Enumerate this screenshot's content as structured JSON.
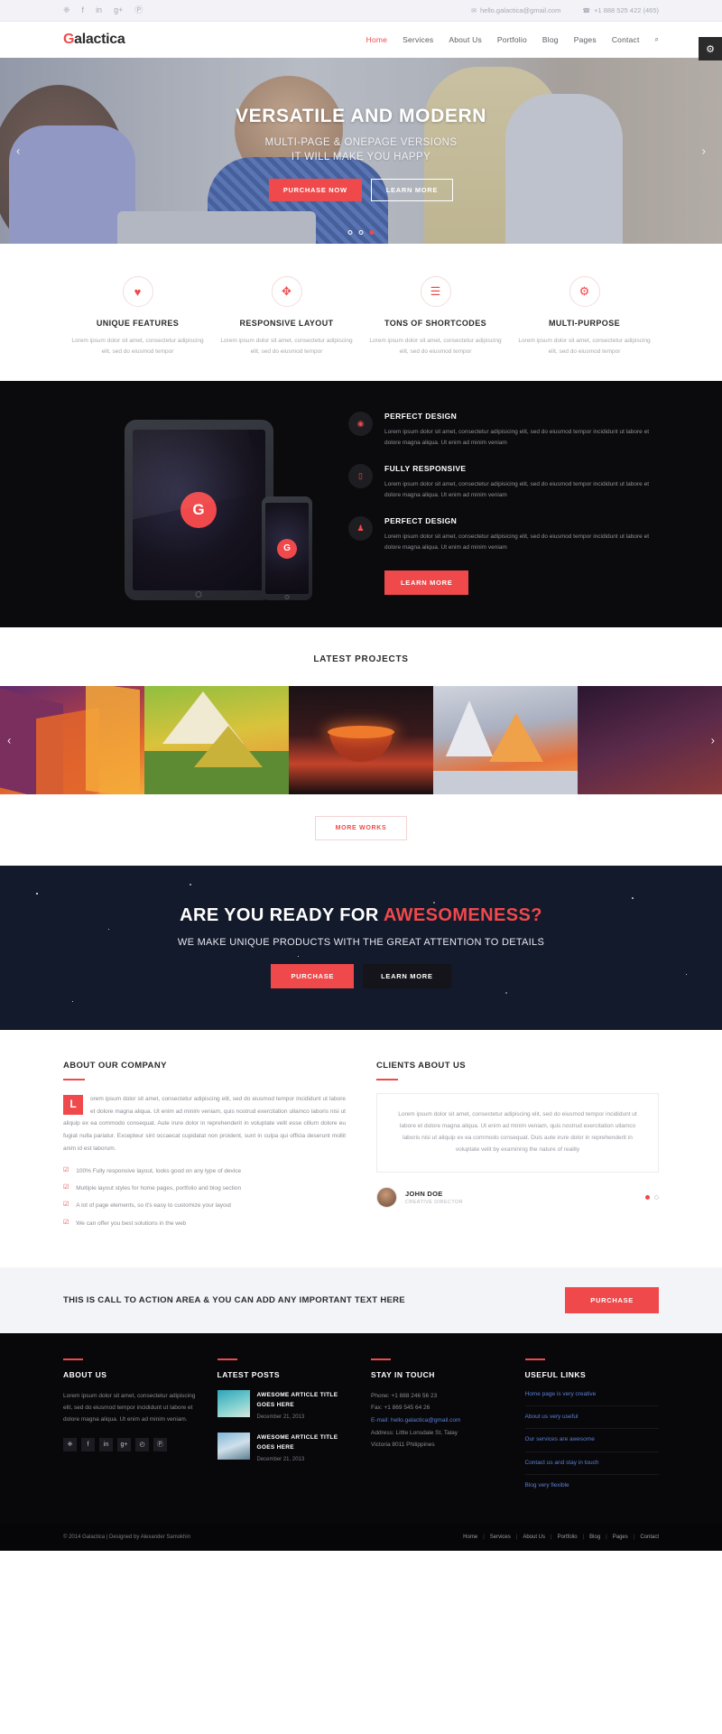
{
  "topbar": {
    "social": [
      {
        "name": "twitter-icon",
        "glyph": "❈"
      },
      {
        "name": "facebook-icon",
        "glyph": "f"
      },
      {
        "name": "linkedin-icon",
        "glyph": "in"
      },
      {
        "name": "google-plus-icon",
        "glyph": "g+"
      },
      {
        "name": "pinterest-icon",
        "glyph": "Ⓟ"
      }
    ],
    "email_icon": "✉",
    "email": "hello.galactica@gmail.com",
    "phone_icon": "☎",
    "phone": "+1 888 525 422 (465)"
  },
  "header": {
    "logo_accent": "G",
    "logo_rest": "alactica",
    "nav": [
      {
        "label": "Home",
        "active": true
      },
      {
        "label": "Services",
        "active": false
      },
      {
        "label": "About Us",
        "active": false
      },
      {
        "label": "Portfolio",
        "active": false
      },
      {
        "label": "Blog",
        "active": false
      },
      {
        "label": "Pages",
        "active": false
      },
      {
        "label": "Contact",
        "active": false
      }
    ],
    "search_icon": "⌕",
    "gear_icon": "⚙"
  },
  "hero": {
    "title": "VERSATILE AND MODERN",
    "subtitle_line1": "MULTI-PAGE & ONEPAGE VERSIONS",
    "subtitle_line2": "IT WILL MAKE YOU HAPPY",
    "btn_primary": "PURCHASE NOW",
    "btn_secondary": "LEARN MORE",
    "prev_icon": "‹",
    "next_icon": "›",
    "slide_count": 3,
    "active_slide": 3
  },
  "features": [
    {
      "icon": "♥",
      "icon_name": "heart-icon",
      "title": "UNIQUE FEATURES",
      "desc": "Lorem ipsum dolor sit amet, consectetur adipiscing elit, sed do eiusmod tempor"
    },
    {
      "icon": "✥",
      "icon_name": "expand-arrows-icon",
      "title": "RESPONSIVE LAYOUT",
      "desc": "Lorem ipsum dolor sit amet, consectetur adipiscing elit, sed do eiusmod tempor"
    },
    {
      "icon": "☰",
      "icon_name": "lines-list-icon",
      "title": "TONS OF SHORTCODES",
      "desc": "Lorem ipsum dolor sit amet, consectetur adipiscing elit, sed do eiusmod tempor"
    },
    {
      "icon": "⚙",
      "icon_name": "gears-icon",
      "title": "MULTI-PURPOSE",
      "desc": "Lorem ipsum dolor sit amet, consectetur adipiscing elit, sed do eiusmod tempor"
    }
  ],
  "showcase": {
    "device_letter": "G",
    "items": [
      {
        "icon": "◉",
        "icon_name": "eye-icon",
        "title": "PERFECT DESIGN",
        "desc": "Lorem ipsum dolor sit amet, consectetur adipisicing elit, sed do eiusmod tempor incididunt ut labore et dolore magna aliqua. Ut enim ad minim veniam"
      },
      {
        "icon": "▯",
        "icon_name": "mobile-icon",
        "title": "FULLY RESPONSIVE",
        "desc": "Lorem ipsum dolor sit amet, consectetur adipisicing elit, sed do eiusmod tempor incididunt ut labore et dolore magna aliqua. Ut enim ad minim veniam"
      },
      {
        "icon": "♟",
        "icon_name": "rocket-icon",
        "title": "PERFECT DESIGN",
        "desc": "Lorem ipsum dolor sit amet, consectetur adipisicing elit, sed do eiusmod tempor incididunt ut labore et dolore magna aliqua. Ut enim ad minim veniam"
      }
    ],
    "btn": "LEARN MORE"
  },
  "projects": {
    "title": "LATEST PROJECTS",
    "prev_icon": "‹",
    "next_icon": "›",
    "more_btn": "MORE WORKS",
    "slides": [
      {
        "name": "project-canyon"
      },
      {
        "name": "project-mountains"
      },
      {
        "name": "project-volcano"
      },
      {
        "name": "project-crystal"
      },
      {
        "name": "project-night"
      }
    ]
  },
  "cta_space": {
    "heading_plain": "ARE YOU READY FOR ",
    "heading_accent": "AWESOMENESS?",
    "sub": "WE MAKE UNIQUE PRODUCTS WITH THE GREAT ATTENTION TO DETAILS",
    "btn_primary": "PURCHASE",
    "btn_secondary": "LEARN MORE"
  },
  "about": {
    "title": "ABOUT OUR COMPANY",
    "dropcap": "L",
    "paragraph": "orem ipsum dolor sit amet, consectetur adipiscing elit, sed do eiusmod tempor incididunt ut labore et dolore magna aliqua. Ut enim ad minim veniam, quis nostrud exercitation ullamco laboris nisi ut aliquip ex ea commodo consequat. Aute irure dolor in reprehenderit in voluptate velit esse cillum dolore eu fugiat nulla pariatur. Excepteur sint occaecat cupidatat non proident, sunt in culpa qui officia deserunt mollit anim id est laborum.",
    "checks": [
      {
        "icon": "☑",
        "text": "100% Fully responsive layout, looks good on any type of device"
      },
      {
        "icon": "☑",
        "text": "Multiple layout styles for home pages, portfolio and blog section"
      },
      {
        "icon": "☑",
        "text": "A lot of page elements, so it's easy to customize your layout"
      },
      {
        "icon": "☑",
        "text": "We can offer you best solutions in the web"
      }
    ]
  },
  "clients": {
    "title": "CLIENTS ABOUT US",
    "quote": "Lorem ipsum dolor sit amet, consectetur adipiscing elit, sed do eiusmod tempor incididunt ut labore et dolore magna aliqua. Ut enim ad minim veniam, quis nostrud exercitation ullamco laboris nisi ut aliquip ex ea commodo consequat. Duis aute irure dolor in reprehenderit in voluptate velit by examining the nature of reality",
    "author_name": "JOHN DOE",
    "author_role": "CREATIVE DIRECTOR",
    "dot_count": 2,
    "active_dot": 1
  },
  "cta_bar": {
    "text": "THIS IS CALL TO ACTION AREA & YOU CAN ADD ANY IMPORTANT TEXT HERE",
    "btn": "PURCHASE"
  },
  "footer": {
    "about": {
      "title": "ABOUT US",
      "text": "Lorem ipsum dolor sit amet, consectetur adipiscing elit, sed do eiusmod tempor incididunt ut labore et dolore magna aliqua. Ut enim ad minim veniam.",
      "social": [
        {
          "name": "twitter-icon",
          "glyph": "❈"
        },
        {
          "name": "facebook-icon",
          "glyph": "f"
        },
        {
          "name": "linkedin-icon",
          "glyph": "in"
        },
        {
          "name": "google-plus-icon",
          "glyph": "g+"
        },
        {
          "name": "rss-icon",
          "glyph": "◴"
        },
        {
          "name": "pinterest-icon",
          "glyph": "Ⓟ"
        }
      ]
    },
    "posts": {
      "title": "LATEST POSTS",
      "items": [
        {
          "title": "AWESOME ARTICLE TITLE GOES HERE",
          "date": "December 21, 2013"
        },
        {
          "title": "AWESOME ARTICLE TITLE GOES HERE",
          "date": "December 21, 2013"
        }
      ]
    },
    "touch": {
      "title": "STAY IN TOUCH",
      "phone": "Phone: +1 888 246 56 23",
      "fax": "Fax: +1 869 545 64 26",
      "email": "E-mail: hello.galactica@gmail.com",
      "address_l1": "Address: Little Lonsdale St, Talay",
      "address_l2": "Victoria 8011 Philippines"
    },
    "links": {
      "title": "USEFUL LINKS",
      "items": [
        "Home page is very creative",
        "About us very useful",
        "Our services are awesome",
        "Contact us and stay in touch",
        "Blog very flexible"
      ]
    }
  },
  "copyright": {
    "text": "© 2014 Galactica | Designed by Alexander Samokhin",
    "nav": [
      "Home",
      "Services",
      "About Us",
      "Portfolio",
      "Blog",
      "Pages",
      "Contact"
    ],
    "sep": "|"
  }
}
